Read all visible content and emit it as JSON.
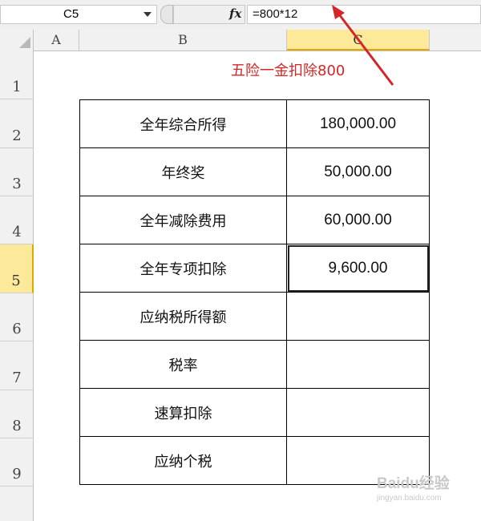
{
  "formula_bar": {
    "name_box": "C5",
    "fx_label": "fx",
    "formula": "=800*12"
  },
  "columns": [
    "A",
    "B",
    "C"
  ],
  "selected_column": "C",
  "rows": [
    "1",
    "2",
    "3",
    "4",
    "5",
    "6",
    "7",
    "8",
    "9"
  ],
  "selected_row": "5",
  "table": [
    {
      "label": "全年综合所得",
      "value": "180,000.00"
    },
    {
      "label": "年终奖",
      "value": "50,000.00"
    },
    {
      "label": "全年减除费用",
      "value": "60,000.00"
    },
    {
      "label": "全年专项扣除",
      "value": "9,600.00"
    },
    {
      "label": "应纳税所得额",
      "value": ""
    },
    {
      "label": "税率",
      "value": ""
    },
    {
      "label": "速算扣除",
      "value": ""
    },
    {
      "label": "应纳个税",
      "value": ""
    }
  ],
  "annotation": {
    "text": "五险一金扣除800",
    "color": "#d42626"
  },
  "watermark": {
    "main": "Baidu经验",
    "sub": "jingyan.baidu.com"
  }
}
